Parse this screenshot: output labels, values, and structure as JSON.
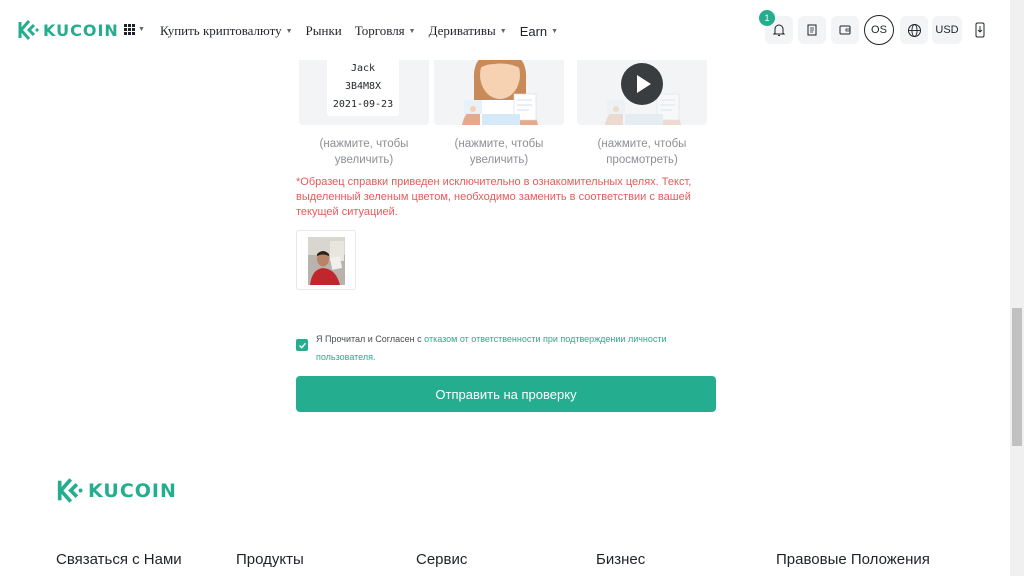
{
  "header": {
    "logo_text": "KUCOIN",
    "nav": [
      "Купить криптовалюту",
      "Рынки",
      "Торговля",
      "Деривативы",
      "Earn"
    ],
    "notification_count": "1",
    "account_initials": "OS",
    "currency": "USD"
  },
  "samples": [
    {
      "paper_lines": [
        "Jack",
        "3B4M8X",
        "2021-09-23"
      ],
      "caption": "(нажмите, чтобы увеличить)"
    },
    {
      "caption": "(нажмите, чтобы увеличить)"
    },
    {
      "caption": "(нажмите, чтобы просмотреть)"
    }
  ],
  "warning": "*Образец справки приведен исключительно в ознакомительных целях. Текст, выделенный зеленым цветом, необходимо заменить в соответствии с вашей текущей ситуацией.",
  "agreement": {
    "prefix": "Я Прочитал и Согласен с ",
    "link": "отказом от ответственности при подтверждении личности пользователя",
    "suffix": "."
  },
  "submit_label": "Отправить на проверку",
  "footer": {
    "logo_text": "KUCOIN",
    "columns": [
      "Связаться с Нами",
      "Продукты",
      "Сервис",
      "Бизнес",
      "Правовые Положения"
    ]
  },
  "colors": {
    "brand": "#24ae8f",
    "warning": "#e85a5a"
  }
}
